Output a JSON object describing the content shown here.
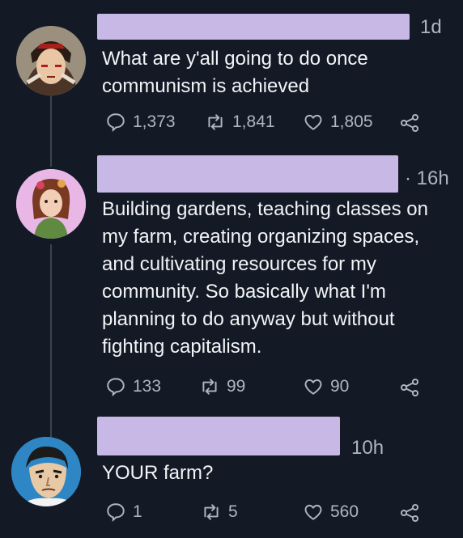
{
  "tweets": [
    {
      "time": "1d",
      "text": "What are y'all going to do once\ncommunism is achieved",
      "replies": "1,373",
      "retweets": "1,841",
      "likes": "1,805"
    },
    {
      "time": "· 16h",
      "text": "Building gardens, teaching classes on\nmy farm,  creating organizing spaces,\nand cultivating resources for my\ncommunity. So basically what I'm\nplanning to do anyway but without\nfighting capitalism.",
      "replies": "133",
      "retweets": "99",
      "likes": "90"
    },
    {
      "time": "10h",
      "text": "YOUR farm?",
      "replies": "1",
      "retweets": "5",
      "likes": "560"
    }
  ],
  "colors": {
    "background": "#131a26",
    "redaction": "#c8b8e6",
    "muted": "#aeb6bf"
  }
}
